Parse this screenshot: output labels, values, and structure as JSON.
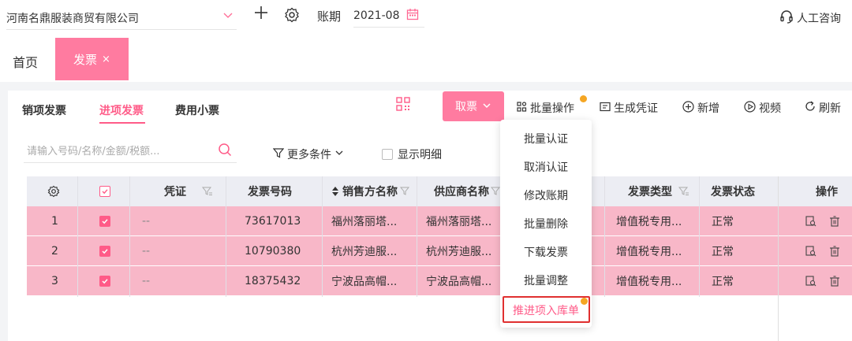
{
  "topbar": {
    "company": "河南名鼎服装商贸有限公司",
    "period_label": "账期",
    "period_value": "2021-08",
    "service": "人工咨询"
  },
  "tabs": {
    "home": "首页",
    "invoice": "发票",
    "close": "×"
  },
  "subtabs": [
    "销项发票",
    "进项发票",
    "费用小票"
  ],
  "search": {
    "placeholder": "请输入号码/名称/金额/税额..."
  },
  "toolbar": {
    "fetch": "取票",
    "batch": "批量操作",
    "voucher": "生成凭证",
    "add": "新增",
    "video": "视频",
    "refresh": "刷新"
  },
  "filters": {
    "more": "更多条件",
    "show_detail": "显示明细"
  },
  "table": {
    "headers": {
      "voucher": "凭证",
      "number": "发票号码",
      "seller": "销售方名称",
      "supplier": "供应商名称",
      "type": "发票类型",
      "status": "发票状态",
      "ops": "操作"
    },
    "rows": [
      {
        "idx": "1",
        "voucher": "--",
        "number": "73617013",
        "seller": "福州落丽塔...",
        "supplier": "福州落丽塔...",
        "type": "增值税专用...",
        "status": "正常"
      },
      {
        "idx": "2",
        "voucher": "--",
        "number": "10790380",
        "seller": "杭州芳迪服...",
        "supplier": "杭州芳迪服...",
        "type": "增值税专用...",
        "status": "正常"
      },
      {
        "idx": "3",
        "voucher": "--",
        "number": "18375432",
        "seller": "宁波品高帽...",
        "supplier": "宁波品高帽...",
        "type": "增值税专用...",
        "status": "正常"
      }
    ]
  },
  "dropdown": {
    "items": [
      "批量认证",
      "取消认证",
      "修改账期",
      "批量删除",
      "下载发票",
      "批量调整",
      "推进项入库单"
    ]
  },
  "colors": {
    "accent": "#ff5b88",
    "tab_bg": "#ff7ba0",
    "row_bg": "#f8b7c8",
    "highlight_border": "#e03030",
    "badge_dot": "#f5a623"
  }
}
